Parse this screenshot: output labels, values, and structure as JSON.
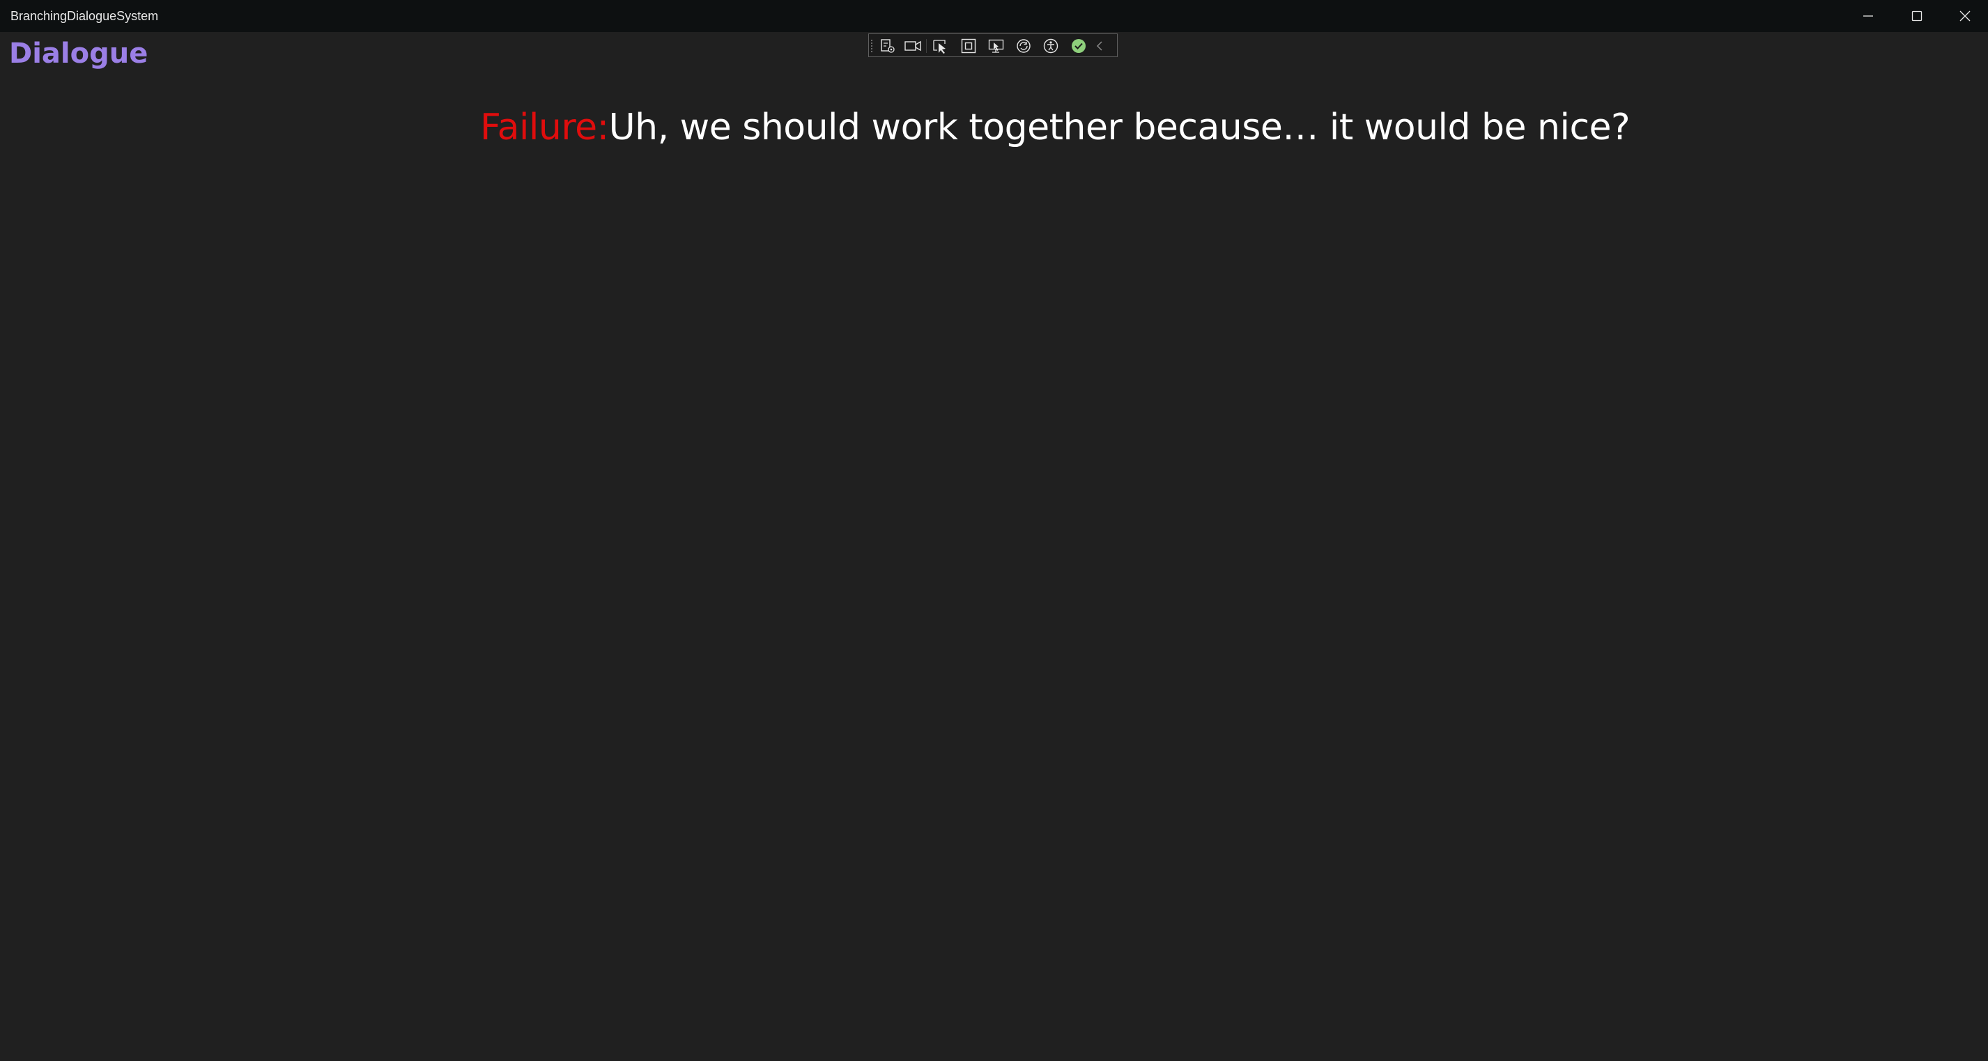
{
  "window": {
    "title": "BranchingDialogueSystem"
  },
  "page": {
    "title": "Dialogue",
    "title_color": "#9b7fe6"
  },
  "dialogue": {
    "speaker": "Failure:",
    "speaker_color": "#e00d0d",
    "text": "Uh, we should work together because… it would be nice?"
  },
  "debug_toolbar": {
    "tools": [
      "live-visual-tree-icon",
      "camera-icon",
      "select-element-icon",
      "display-layout-adorners-icon",
      "track-focus-icon",
      "hot-reload-icon",
      "accessibility-icon",
      "binding-check-icon",
      "collapse-chevron-icon"
    ]
  }
}
